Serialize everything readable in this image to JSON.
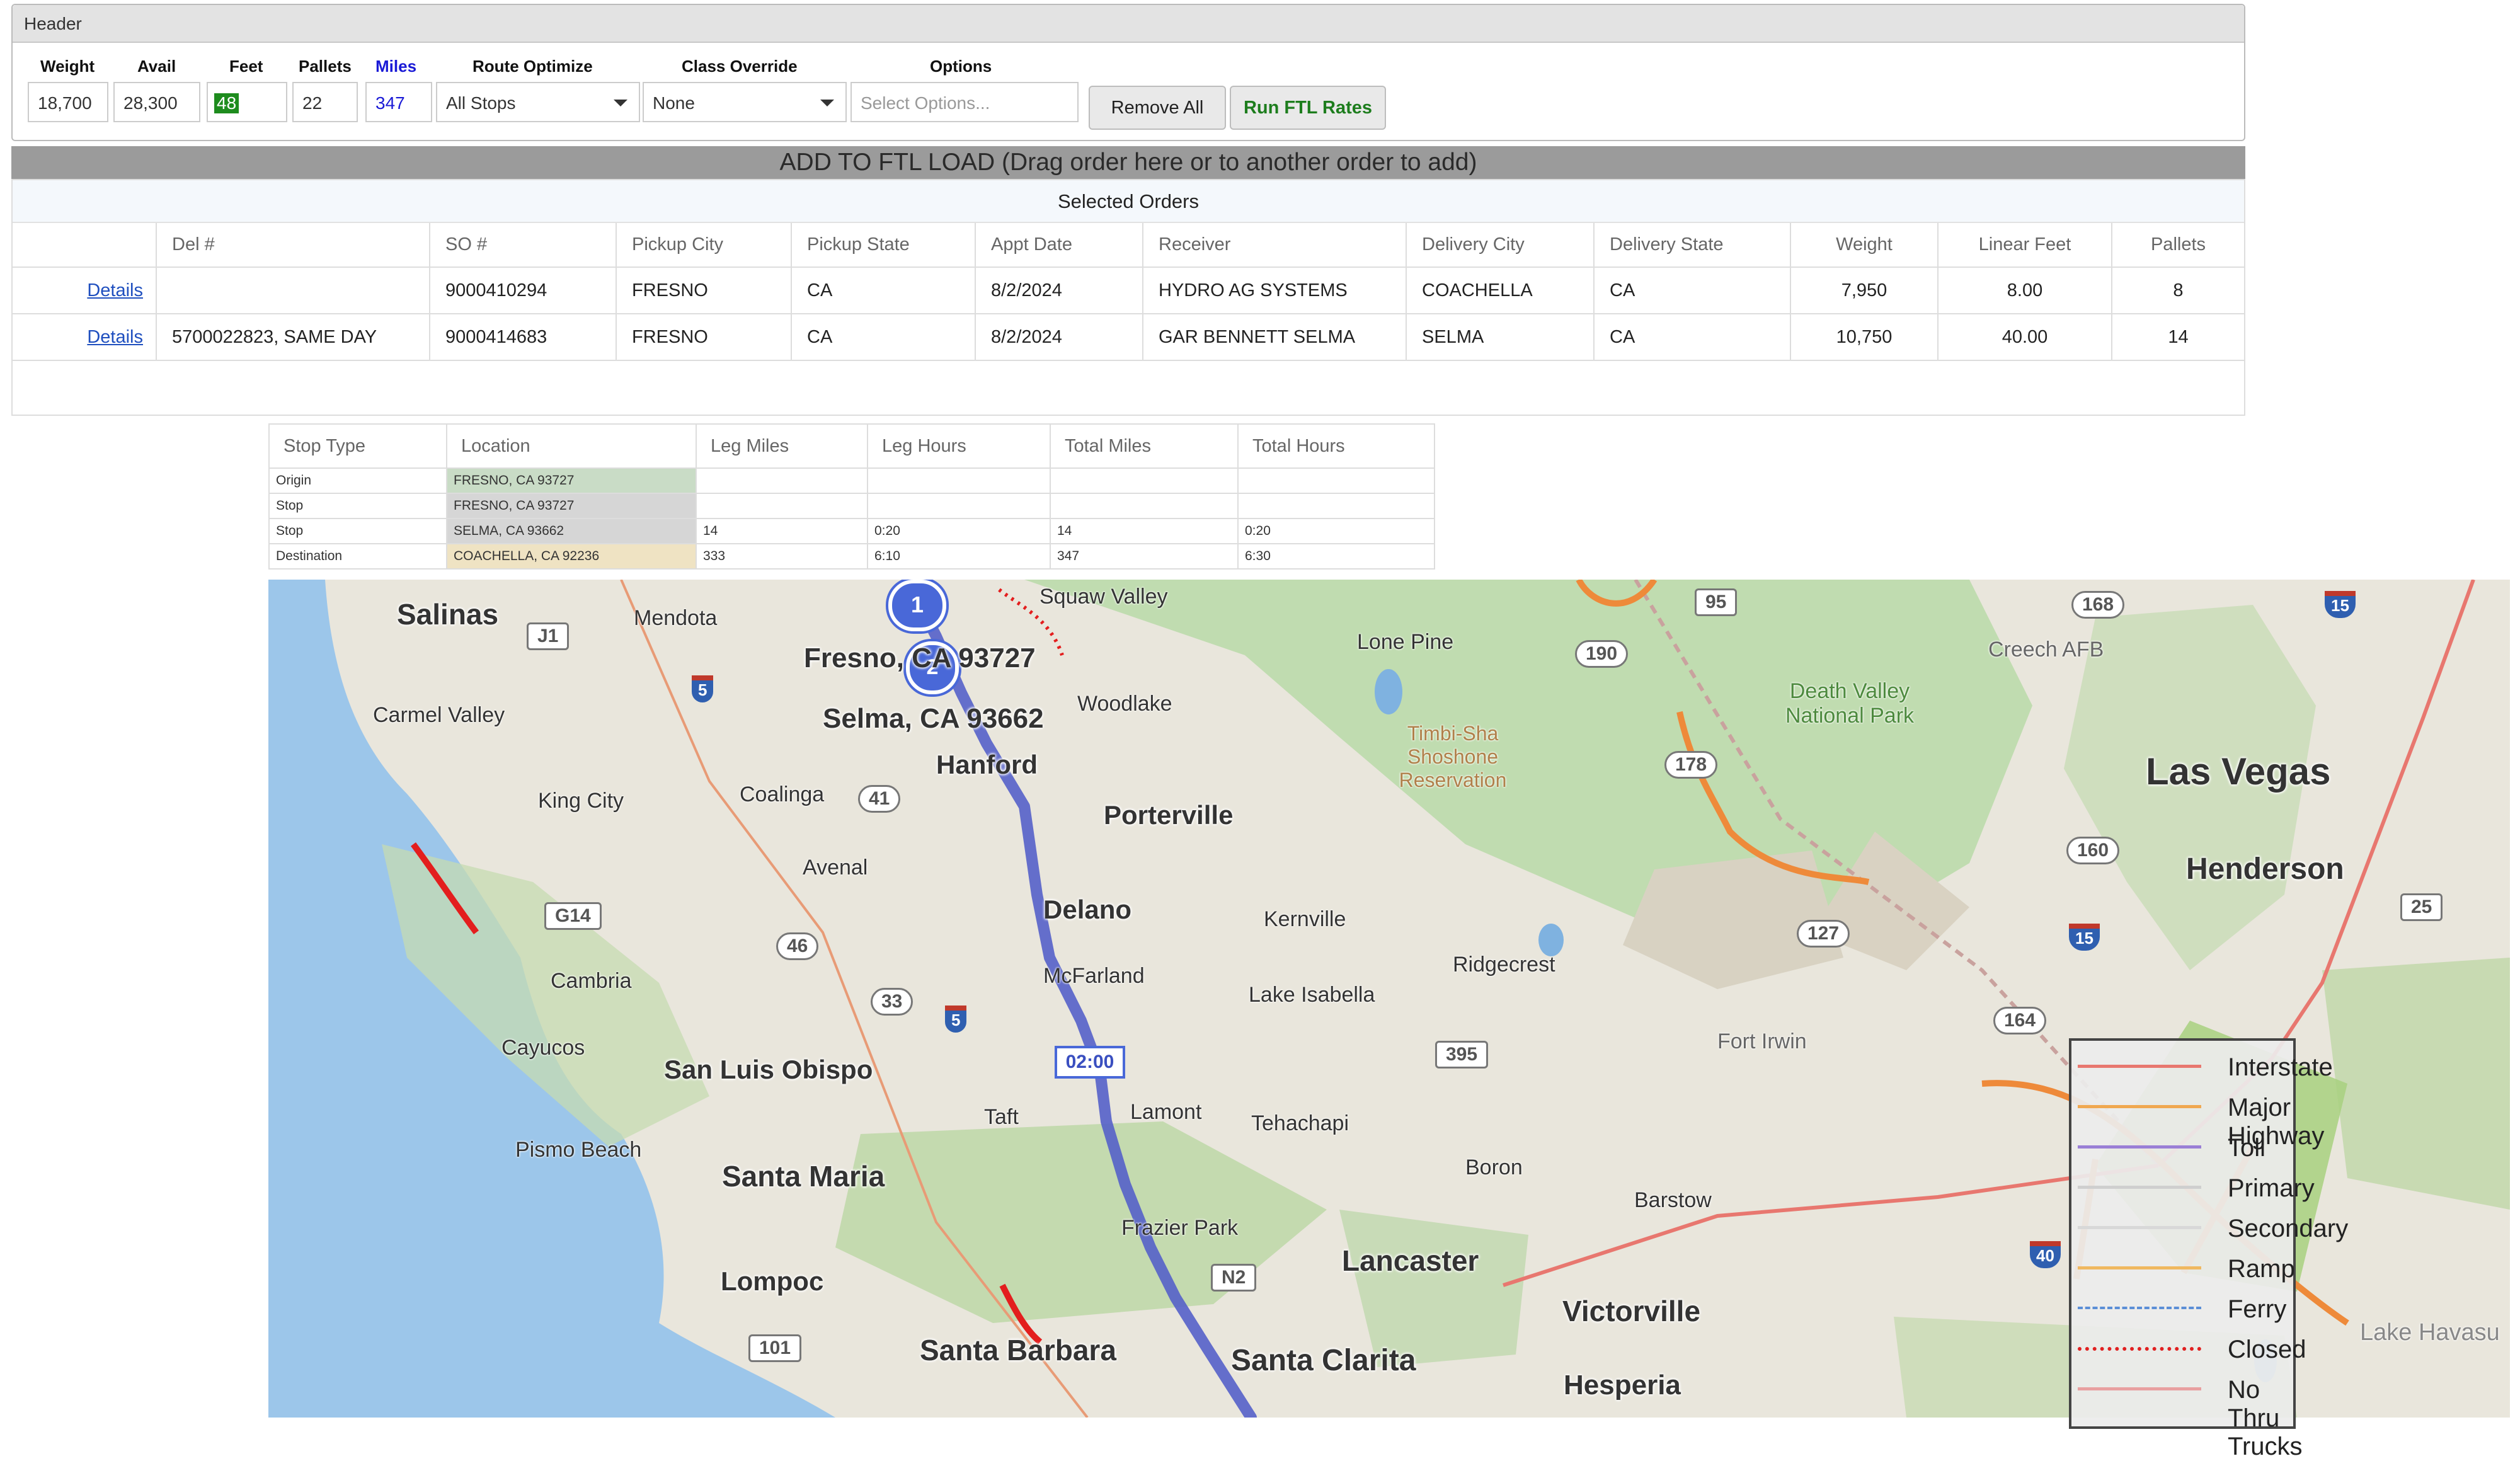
{
  "header": {
    "title": "Header",
    "fields": {
      "weight": {
        "label": "Weight",
        "value": "18,700"
      },
      "avail": {
        "label": "Avail",
        "value": "28,300"
      },
      "feet": {
        "label": "Feet",
        "value": "48"
      },
      "pallets": {
        "label": "Pallets",
        "value": "22"
      },
      "miles": {
        "label": "Miles",
        "value": "347"
      },
      "route_optimize": {
        "label": "Route Optimize",
        "value": "All Stops"
      },
      "class_override": {
        "label": "Class Override",
        "value": "None"
      },
      "options": {
        "label": "Options",
        "placeholder": "Select Options..."
      }
    },
    "buttons": {
      "remove_all": "Remove All",
      "run_ftl": "Run FTL Rates"
    }
  },
  "add_band": "ADD TO FTL LOAD (Drag order here or to another order to add)",
  "orders": {
    "title": "Selected Orders",
    "columns": [
      "",
      "Del #",
      "SO #",
      "Pickup City",
      "Pickup State",
      "Appt Date",
      "Receiver",
      "Delivery City",
      "Delivery State",
      "Weight",
      "Linear Feet",
      "Pallets"
    ],
    "rows": [
      {
        "link": "Details",
        "del": "",
        "so": "9000410294",
        "pickup_city": "FRESNO",
        "pickup_state": "CA",
        "appt": "8/2/2024",
        "receiver": "HYDRO AG SYSTEMS",
        "delivery_city": "COACHELLA",
        "delivery_state": "CA",
        "weight": "7,950",
        "linear_feet": "8.00",
        "pallets": "8"
      },
      {
        "link": "Details",
        "del": "5700022823, SAME DAY",
        "so": "9000414683",
        "pickup_city": "FRESNO",
        "pickup_state": "CA",
        "appt": "8/2/2024",
        "receiver": "GAR BENNETT SELMA",
        "delivery_city": "SELMA",
        "delivery_state": "CA",
        "weight": "10,750",
        "linear_feet": "40.00",
        "pallets": "14"
      }
    ]
  },
  "stops": {
    "columns": [
      "Stop Type",
      "Location",
      "Leg Miles",
      "Leg Hours",
      "Total Miles",
      "Total Hours"
    ],
    "rows": [
      {
        "type": "Origin",
        "location": "FRESNO, CA 93727",
        "leg_miles": "",
        "leg_hours": "",
        "total_miles": "",
        "total_hours": ""
      },
      {
        "type": "Stop",
        "location": "FRESNO, CA 93727",
        "leg_miles": "",
        "leg_hours": "",
        "total_miles": "",
        "total_hours": ""
      },
      {
        "type": "Stop",
        "location": "SELMA, CA 93662",
        "leg_miles": "14",
        "leg_hours": "0:20",
        "total_miles": "14",
        "total_hours": "0:20"
      },
      {
        "type": "Destination",
        "location": "COACHELLA, CA 92236",
        "leg_miles": "333",
        "leg_hours": "6:10",
        "total_miles": "347",
        "total_hours": "6:30"
      }
    ],
    "location_colors": [
      "#c9dcc6",
      "#d6d6d6",
      "#d6d6d6",
      "#efe3c3"
    ]
  },
  "map": {
    "markers": [
      "1",
      "2"
    ],
    "route_time_label": "02:00",
    "route_color": "#5561c9",
    "stop_labels": [
      "Fresno, CA 93727",
      "Selma, CA 93662"
    ],
    "cities_major": [
      "Salinas",
      "Hanford",
      "Porterville",
      "Delano",
      "San Luis Obispo",
      "Santa Maria",
      "Lompoc",
      "Santa Barbara",
      "Santa Clarita",
      "Lancaster",
      "Victorville",
      "Hesperia",
      "Las Vegas",
      "Henderson"
    ],
    "towns": [
      "Mendota",
      "Squaw Valley",
      "Carmel Valley",
      "King City",
      "Coalinga",
      "Woodlake",
      "Lone Pine",
      "Avenal",
      "Kernville",
      "Ridgecrest",
      "McFarland",
      "Lake Isabella",
      "Cambria",
      "Cayucos",
      "Lamont",
      "Tehachapi",
      "Pismo Beach",
      "Taft",
      "Boron",
      "Barstow",
      "Frazier Park",
      "Creech AFB",
      "Fort Irwin",
      "Lake Havasu"
    ],
    "parks": [
      "Death Valley National Park",
      "Timbi-Sha Shoshone Reservation"
    ],
    "state_shields": [
      "J1",
      "G14",
      "41",
      "46",
      "33",
      "190",
      "178",
      "127",
      "160",
      "168",
      "95",
      "25",
      "164",
      "395",
      "101",
      "N2"
    ],
    "interstate_shields": [
      "5",
      "5",
      "15",
      "15",
      "40"
    ],
    "legend": [
      {
        "label": "Interstate",
        "color": "#e8776f",
        "style": "solid"
      },
      {
        "label": "Major Highway",
        "color": "#f0a850",
        "style": "solid"
      },
      {
        "label": "Toll",
        "color": "#9a7fd6",
        "style": "solid"
      },
      {
        "label": "Primary",
        "color": "#cfcfcf",
        "style": "solid"
      },
      {
        "label": "Secondary",
        "color": "#d8d8d8",
        "style": "solid"
      },
      {
        "label": "Ramp",
        "color": "#f0b860",
        "style": "solid"
      },
      {
        "label": "Ferry",
        "color": "#5b8ed6",
        "style": "dashed"
      },
      {
        "label": "Closed",
        "color": "#e02020",
        "style": "dotted"
      },
      {
        "label": "No Thru Trucks",
        "color": "#e8a0a0",
        "style": "solid"
      }
    ]
  }
}
